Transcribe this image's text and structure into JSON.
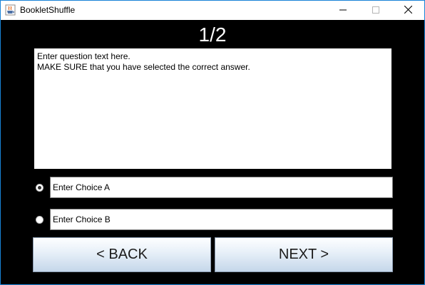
{
  "window": {
    "title": "BookletShuffle"
  },
  "header": {
    "counter": "1/2"
  },
  "question": {
    "text": "Enter question text here.\nMAKE SURE that you have selected the correct answer."
  },
  "choices": [
    {
      "label": "Enter Choice A",
      "selected": true
    },
    {
      "label": "Enter Choice B",
      "selected": false
    }
  ],
  "navigation": {
    "back_label": "< BACK",
    "next_label": "NEXT >"
  },
  "icons": {
    "app": "java-cup-icon",
    "minimize": "minimize-icon",
    "maximize": "maximize-icon",
    "close": "close-icon"
  },
  "colors": {
    "background": "#000000",
    "window_border": "#1883d7",
    "counter_text": "#ffffff"
  }
}
